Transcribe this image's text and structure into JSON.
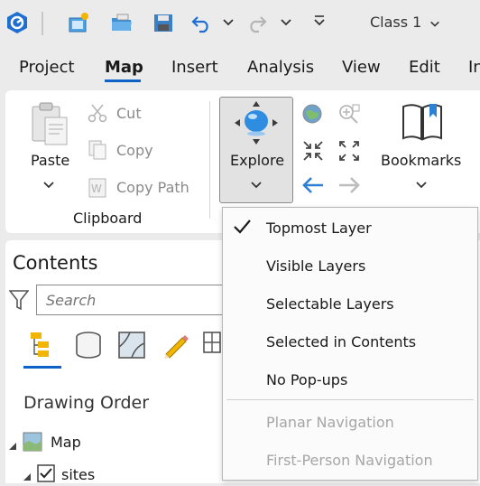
{
  "quick_access": {
    "project_name": "Class 1",
    "icons": [
      "app-logo-icon",
      "new-project-icon",
      "open-project-icon",
      "save-project-icon",
      "undo-icon",
      "redo-icon",
      "customize-icon"
    ]
  },
  "tabs": [
    {
      "label": "Project"
    },
    {
      "label": "Map",
      "active": true
    },
    {
      "label": "Insert"
    },
    {
      "label": "Analysis"
    },
    {
      "label": "View"
    },
    {
      "label": "Edit"
    },
    {
      "label": "In"
    }
  ],
  "clipboard": {
    "paste": "Paste",
    "cut": "Cut",
    "copy": "Copy",
    "copy_path": "Copy Path",
    "group_label": "Clipboard"
  },
  "navigate": {
    "explore": "Explore",
    "bookmarks": "Bookmarks"
  },
  "explore_menu": {
    "items": [
      {
        "label": "Topmost Layer",
        "checked": true
      },
      {
        "label": "Visible Layers"
      },
      {
        "label": "Selectable Layers"
      },
      {
        "label": "Selected in Contents"
      },
      {
        "label": "No Pop-ups"
      }
    ],
    "disabled_items": [
      {
        "label": "Planar Navigation"
      },
      {
        "label": "First-Person Navigation"
      }
    ]
  },
  "contents": {
    "title": "Contents",
    "search_placeholder": "Search",
    "drawing_order": "Drawing Order",
    "tree": [
      {
        "label": "Map"
      },
      {
        "label": "sites",
        "checked": true
      }
    ]
  },
  "colors": {
    "accent": "#0d62c7",
    "ribbon_bg": "#ffffff",
    "frame_bg": "#ebebeb"
  }
}
